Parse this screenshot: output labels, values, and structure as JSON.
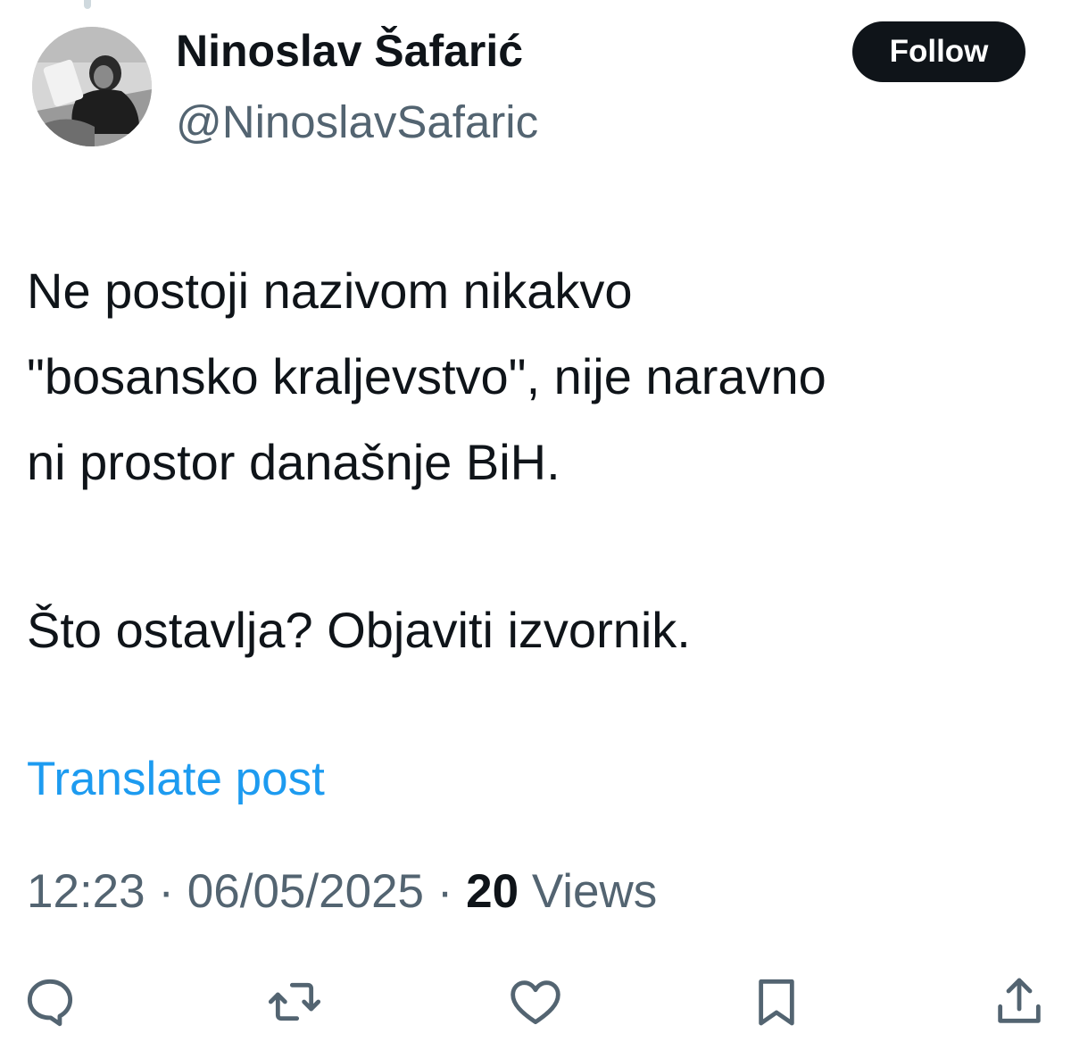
{
  "author": {
    "name": "Ninoslav Šafarić",
    "handle": "@NinoslavSafaric",
    "avatar_icon": "profile-photo"
  },
  "follow_button": {
    "label": "Follow"
  },
  "post": {
    "lines": [
      "Ne postoji nazivom nikakvo",
      "\"bosansko kraljevstvo\", nije naravno",
      "ni prostor današnje BiH.",
      "Što ostavlja? Objaviti izvornik."
    ],
    "translate_label": "Translate post"
  },
  "meta": {
    "time": "12:23",
    "date": "06/05/2025",
    "separator": "·",
    "views_count": "20",
    "views_label": "Views"
  },
  "actions": [
    {
      "name": "reply",
      "icon": "reply-icon"
    },
    {
      "name": "repost",
      "icon": "repost-icon"
    },
    {
      "name": "like",
      "icon": "heart-icon"
    },
    {
      "name": "bookmark",
      "icon": "bookmark-icon"
    },
    {
      "name": "share",
      "icon": "share-icon"
    }
  ],
  "colors": {
    "text": "#0f1419",
    "secondary": "#536471",
    "link": "#1d9bf0",
    "button_bg": "#0f1419"
  }
}
